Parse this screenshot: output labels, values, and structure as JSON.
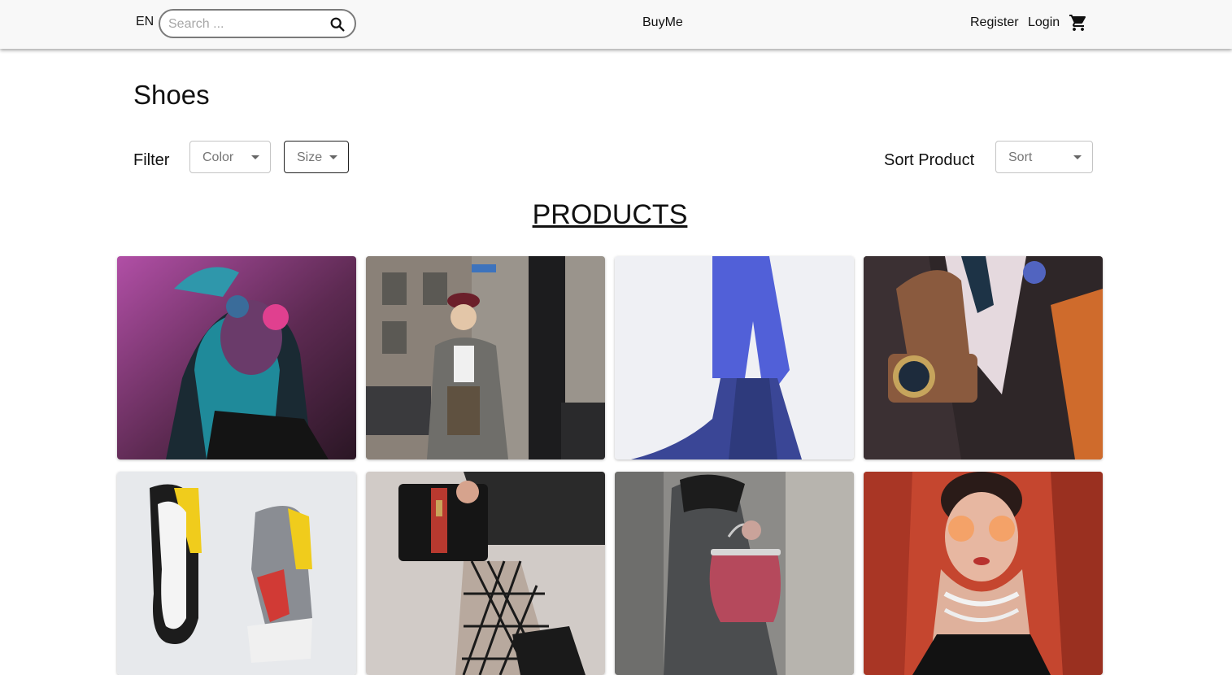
{
  "header": {
    "language": "EN",
    "search_placeholder": "Search ...",
    "brand": "BuyMe",
    "register": "Register",
    "login": "Login"
  },
  "page": {
    "title": "Shoes",
    "products_heading": "PRODUCTS"
  },
  "filters": {
    "label": "Filter",
    "color": "Color",
    "size": "Size"
  },
  "sort": {
    "label": "Sort Product",
    "value": "Sort"
  },
  "products": [
    {
      "image": "woman-neon-sunglasses"
    },
    {
      "image": "woman-beret-coat-street"
    },
    {
      "image": "blue-fur-coat"
    },
    {
      "image": "man-suit-wristwatch"
    },
    {
      "image": "sneakers"
    },
    {
      "image": "black-handbag-fishnet"
    },
    {
      "image": "pink-handbag-sweater"
    },
    {
      "image": "woman-orange-sunglasses"
    }
  ]
}
